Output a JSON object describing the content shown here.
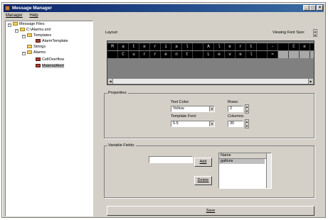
{
  "window": {
    "title": "Message Manager"
  },
  "menu": [
    "Manager",
    "Help"
  ],
  "tree": [
    {
      "label": "Message Files",
      "type": "folder",
      "depth": 0
    },
    {
      "label": "C:\\Alarms.xml",
      "type": "folder",
      "depth": 1
    },
    {
      "label": "Templates",
      "type": "folder",
      "depth": 2
    },
    {
      "label": "AlarmTemplate",
      "type": "doc",
      "depth": 3
    },
    {
      "label": "Strings",
      "type": "folder",
      "depth": 2
    },
    {
      "label": "Alarms",
      "type": "folder",
      "depth": 2
    },
    {
      "label": "CellOverflow",
      "type": "doc",
      "depth": 3
    },
    {
      "label": "MaterialAlert",
      "type": "doc",
      "depth": 3,
      "selected": true
    }
  ],
  "layout": {
    "label": "Layout:",
    "viewing_font_label": "Viewing Font Size:",
    "row1": [
      "M",
      "a",
      "t",
      "e",
      "r",
      "i",
      "a",
      "l",
      " ",
      "A",
      "l",
      "e",
      "r",
      "t",
      " ",
      "-",
      " ",
      "C",
      "e",
      "l"
    ],
    "row2": [
      " ",
      "C",
      "u",
      "r",
      "r",
      "e",
      "n",
      "t",
      " ",
      "L",
      "e",
      "v",
      "e",
      "l",
      " ",
      "=",
      "",
      "",
      "",
      ""
    ]
  },
  "properties": {
    "title": "Properties:",
    "text_color_label": "Text Color:",
    "text_color": "Yellow",
    "template_font_label": "Template Font:",
    "template_font": "5.5",
    "rows_label": "Rows:",
    "rows": "2",
    "columns_label": "Columns:",
    "columns": "30"
  },
  "variables": {
    "title": "Variable Fields:",
    "input_value": "",
    "add_label": "Add",
    "delete_label": "Delete",
    "list_header": "Name",
    "items": [
      "gallons"
    ]
  },
  "save_label": "Save"
}
